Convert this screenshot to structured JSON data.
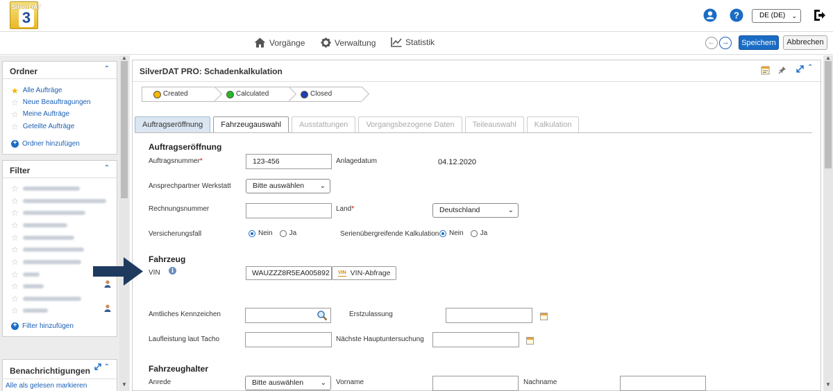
{
  "app": {
    "logo_text": "SilverDAT",
    "logo_number": "3",
    "language": "DE (DE)"
  },
  "nav": {
    "items": [
      {
        "label": "Vorgänge",
        "icon": "home-icon"
      },
      {
        "label": "Verwaltung",
        "icon": "gear-icon"
      },
      {
        "label": "Statistik",
        "icon": "chart-icon"
      }
    ],
    "save_label": "Speichern",
    "cancel_label": "Abbrechen"
  },
  "sidebar": {
    "ordner": {
      "title": "Ordner",
      "items": [
        "Alle Aufträge",
        "Neue Beauftragungen",
        "Meine Aufträge",
        "Geteilte Aufträge"
      ],
      "add_label": "Ordner hinzufügen"
    },
    "filter": {
      "title": "Filter",
      "add_label": "Filter hinzufügen"
    },
    "notifications": {
      "title": "Benachrichtigungen",
      "mark_read_label": "Alle als gelesen markieren"
    }
  },
  "main": {
    "title": "SilverDAT PRO: Schadenkalkulation",
    "steps": [
      {
        "label": "Created",
        "color": "#f5b700"
      },
      {
        "label": "Calculated",
        "color": "#22bb22"
      },
      {
        "label": "Closed",
        "color": "#1f3fb0"
      }
    ],
    "tabs": [
      "Auftragseröffnung",
      "Fahrzeugauswahl",
      "Ausstattungen",
      "Vorgangsbezogene Daten",
      "Teileauswahl",
      "Kalkulation"
    ],
    "auftrag": {
      "section_title": "Auftragseröffnung",
      "auftragsnummer_label": "Auftragsnummer",
      "auftragsnummer_value": "123-456",
      "anlagedatum_label": "Anlagedatum",
      "anlagedatum_value": "04.12.2020",
      "ansprechpartner_label": "Ansprechpartner Werkstatt",
      "ansprechpartner_value": "Bitte auswählen",
      "rechnungsnummer_label": "Rechnungsnummer",
      "rechnungsnummer_value": "",
      "land_label": "Land",
      "land_value": "Deutschland",
      "versicherungsfall_label": "Versicherungsfall",
      "serien_label": "Serienübergreifende Kalkulation",
      "nein": "Nein",
      "ja": "Ja"
    },
    "fahrzeug": {
      "section_title": "Fahrzeug",
      "vin_label": "VIN",
      "vin_value": "WAUZZZ8R5EA005892",
      "vin_badge": "VIN",
      "vin_button": "VIN-Abfrage",
      "kennzeichen_label": "Amtliches Kennzeichen",
      "erstzulassung_label": "Erstzulassung",
      "laufleistung_label": "Laufleistung laut Tacho",
      "hu_label": "Nächste Hauptuntersuchung"
    },
    "halter": {
      "section_title": "Fahrzeughalter",
      "anrede_label": "Anrede",
      "anrede_value": "Bitte auswählen",
      "vorname_label": "Vorname",
      "nachname_label": "Nachname"
    }
  }
}
